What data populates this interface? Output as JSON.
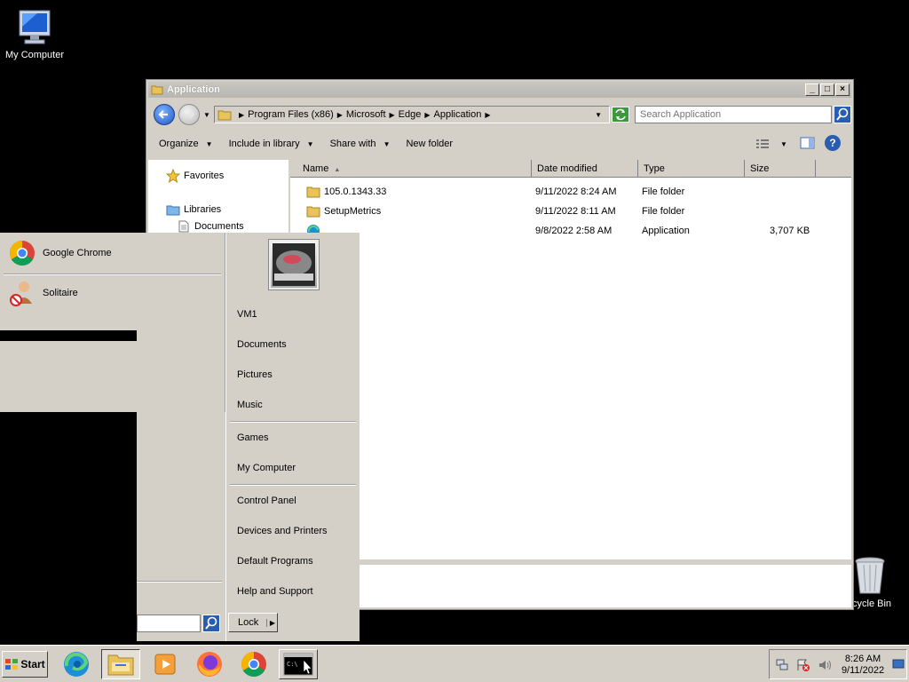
{
  "desktop": {
    "icons": [
      {
        "label": "My Computer"
      },
      {
        "label": "cycle Bin"
      }
    ]
  },
  "explorer": {
    "title": "Application",
    "address": {
      "crumbs": [
        "Program Files (x86)",
        "Microsoft",
        "Edge",
        "Application"
      ]
    },
    "search": {
      "placeholder": "Search Application"
    },
    "toolbar": {
      "organize": "Organize",
      "include_in_library": "Include in library",
      "share_with": "Share with",
      "new_folder": "New folder"
    },
    "nav": {
      "favorites": "Favorites",
      "libraries": "Libraries",
      "documents": "Documents"
    },
    "columns": {
      "name": "Name",
      "date_modified": "Date modified",
      "type": "Type",
      "size": "Size"
    },
    "files": [
      {
        "name": "105.0.1343.33",
        "date": "9/11/2022 8:24 AM",
        "type": "File folder",
        "size": ""
      },
      {
        "name": "SetupMetrics",
        "date": "9/11/2022 8:11 AM",
        "type": "File folder",
        "size": ""
      },
      {
        "name": "",
        "date": "9/8/2022 2:58 AM",
        "type": "Application",
        "size": "3,707 KB"
      }
    ]
  },
  "start_menu": {
    "programs": [
      {
        "label": "Google Chrome",
        "icon": "chrome-icon"
      },
      {
        "label": "Solitaire",
        "icon": "solitaire-icon"
      }
    ],
    "right": {
      "user": "VM1",
      "documents": "Documents",
      "pictures": "Pictures",
      "music": "Music",
      "games": "Games",
      "my_computer": "My Computer",
      "control_panel": "Control Panel",
      "devices_printers": "Devices and Printers",
      "default_programs": "Default Programs",
      "help_support": "Help and Support"
    },
    "lock_label": "Lock"
  },
  "taskbar": {
    "start_label": "Start",
    "clock": {
      "time": "8:26 AM",
      "date": "9/11/2022"
    }
  },
  "colors": {
    "desktop": "#000000",
    "chrome_face": "#d4d0c8",
    "accent_blue": "#2a5cb0"
  }
}
